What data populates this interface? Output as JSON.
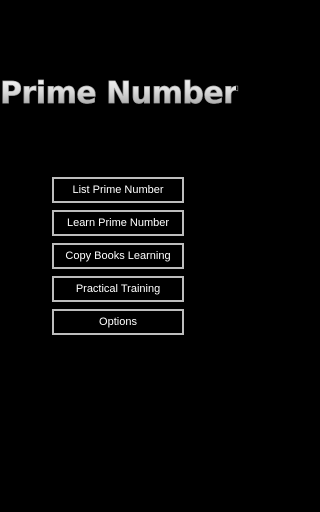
{
  "app": {
    "title": "Prime Number"
  },
  "menu": {
    "items": [
      {
        "label": "List Prime Number"
      },
      {
        "label": "Learn Prime Number"
      },
      {
        "label": "Copy Books Learning"
      },
      {
        "label": "Practical Training"
      },
      {
        "label": "Options"
      }
    ]
  },
  "colors": {
    "background": "#000000",
    "button_border": "#bdbdbd",
    "button_text": "#ffffff"
  }
}
